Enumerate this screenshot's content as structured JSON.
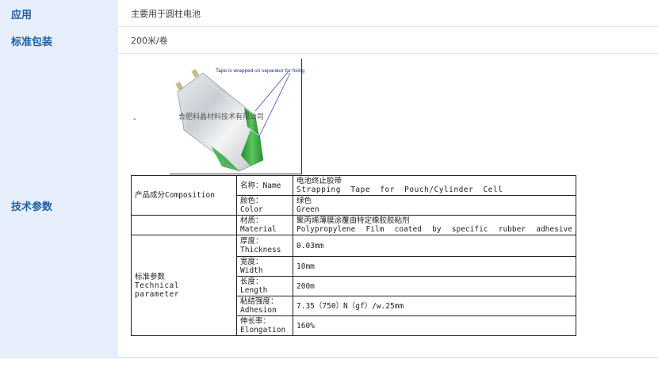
{
  "rows": {
    "application": {
      "label": "应用",
      "value": "主要用于圆柱电池"
    },
    "packaging": {
      "label": "标准包装",
      "value": "200米/卷"
    },
    "tech": {
      "label": "技术参数"
    }
  },
  "photo": {
    "caption": "Tape is wrapped on separator for fixing",
    "watermark": "合肥科晶材料技术有限公司",
    "dash": "-"
  },
  "spec_table": {
    "composition_label": "产品成分Composition",
    "name_label": "名称：Name",
    "name_value_cn": "电池终止胶带",
    "name_value_en": "Strapping Tape for Pouch/Cylinder Cell",
    "color_label_cn": "颜色：",
    "color_label_en": "Color",
    "color_value_cn": "绿色",
    "color_value_en": "Green",
    "material_label_cn": "材质：",
    "material_label_en": "Material",
    "material_value_cn": "聚丙烯薄膜涂覆由特定橡胶胶粘剂",
    "material_value_en": "Polypropylene Film coated by specific rubber adhesive",
    "technical_label_cn": "标准参数",
    "technical_label_en": "Technical parameter",
    "thickness_label_cn": "厚度：",
    "thickness_label_en": "Thickness",
    "thickness_value": "0.03mm",
    "width_label_cn": "宽度：",
    "width_label_en": "Width",
    "width_value": "10mm",
    "length_label_cn": "长度：",
    "length_label_en": "Length",
    "length_value": "200m",
    "adhesion_label_cn": "粘结强度：",
    "adhesion_label_en": "Adhesion",
    "adhesion_value": "7.35（750）N（gf）/w.25mm",
    "elongation_label_cn": "伸长率：",
    "elongation_label_en": "Elongation",
    "elongation_value": "160%"
  },
  "colors": {
    "label_bg": "#e6effb",
    "label_text": "#1d5fa8",
    "tape_green": "#2e9e3a",
    "divider": "#dbe7f4"
  }
}
